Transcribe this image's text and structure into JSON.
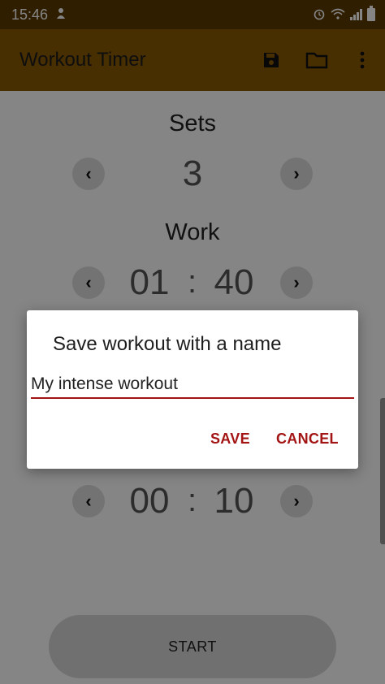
{
  "status_bar": {
    "time": "15:46"
  },
  "app_bar": {
    "title": "Workout Timer"
  },
  "sections": {
    "sets": {
      "label": "Sets",
      "value": "3"
    },
    "work": {
      "label": "Work",
      "minutes": "01",
      "seconds": "40"
    },
    "rest": {
      "minutes": "00",
      "seconds": "10"
    }
  },
  "controls": {
    "prev_glyph": "‹",
    "next_glyph": "›",
    "colon": ":"
  },
  "start_button": {
    "label": "START"
  },
  "dialog": {
    "title": "Save workout with a name",
    "input_value": "My intense workout",
    "save_label": "SAVE",
    "cancel_label": "CANCEL"
  },
  "colors": {
    "status_bar": "#5a3a00",
    "app_bar": "#8a5a05",
    "accent": "#a31515"
  }
}
